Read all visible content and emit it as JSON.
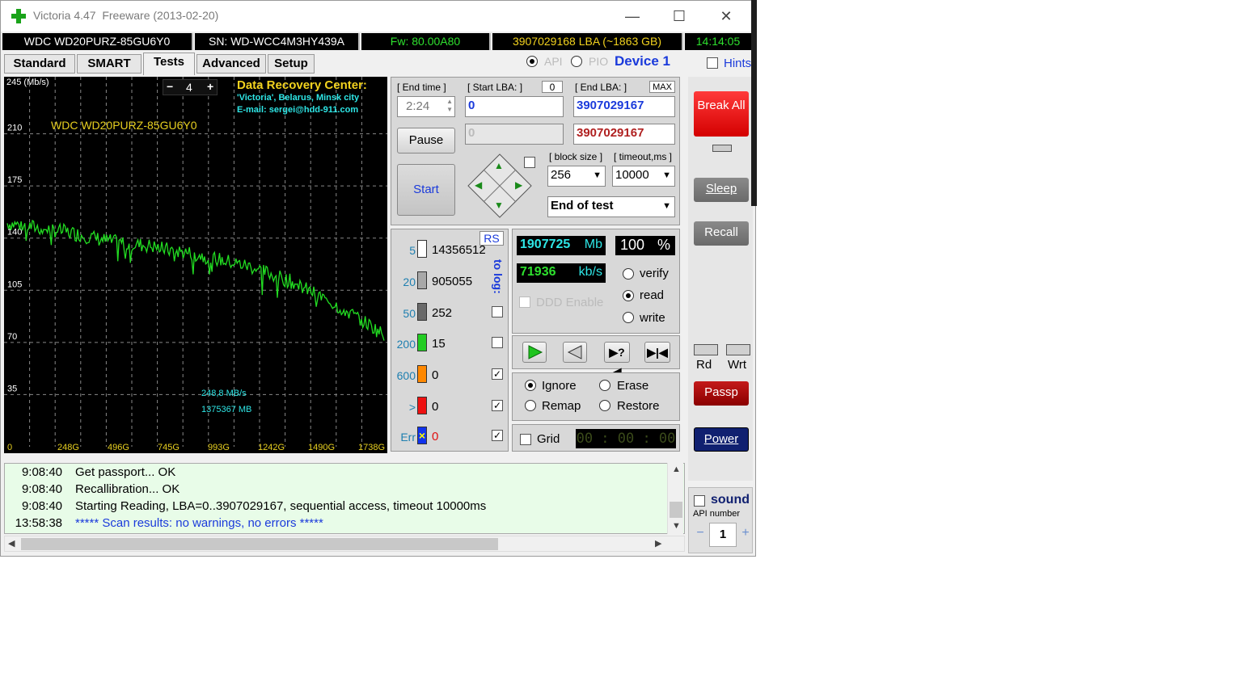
{
  "window": {
    "title": "Victoria 4.47  Freeware (2013-02-20)",
    "minimize": "—",
    "maximize": "☐",
    "close": "✕"
  },
  "info": {
    "model": "WDC WD20PURZ-85GU6Y0",
    "serial": "SN: WD-WCC4M3HY439A",
    "firmware": "Fw: 80.00A80",
    "lba": "3907029168 LBA (~1863 GB)",
    "time": "14:14:05"
  },
  "tabs": [
    "Standard",
    "SMART",
    "Tests",
    "Advanced",
    "Setup"
  ],
  "mode": {
    "api": "API",
    "pio": "PIO",
    "device": "Device 1",
    "hints": "Hints"
  },
  "graph": {
    "ymax_label": "245 (Mb/s)",
    "y_labels": [
      "210",
      "175",
      "140",
      "105",
      "70",
      "35"
    ],
    "x_labels": [
      "0",
      "248G",
      "496G",
      "745G",
      "993G",
      "1242G",
      "1490G",
      "1738G"
    ],
    "stepper_minus": "−",
    "stepper_value": "4",
    "stepper_plus": "+",
    "drc_title": "Data Recovery Center:",
    "drc_line1": "'Victoria', Belarus, Minsk city",
    "drc_line2": "E-mail: sergei@hdd-911.com",
    "drive_label": "WDC WD20PURZ-85GU6Y0",
    "speed_readout": "248,8 MB/s",
    "pos_readout": "1375367 MB"
  },
  "chart_data": {
    "type": "line",
    "ylabel": "(Mb/s)",
    "ylim": [
      0,
      245
    ],
    "x_ticks": [
      "0",
      "248G",
      "496G",
      "745G",
      "993G",
      "1242G",
      "1490G",
      "1738G"
    ],
    "x_gb": [
      0,
      100,
      200,
      300,
      400,
      500,
      600,
      700,
      800,
      900,
      1000,
      1100,
      1200,
      1300,
      1400,
      1500,
      1600,
      1700,
      1800,
      1863
    ],
    "y": [
      150,
      148,
      146,
      144,
      141,
      138,
      136,
      135,
      132,
      130,
      127,
      124,
      121,
      116,
      111,
      104,
      97,
      89,
      81,
      75
    ]
  },
  "controls": {
    "end_time_label": "[ End time ]",
    "end_time_value": "2:24",
    "start_lba_label": "[ Start LBA: ]",
    "start_lba_zero": "0",
    "start_lba_value": "0",
    "end_lba_label": "[ End LBA: ]",
    "end_lba_max": "MAX",
    "end_lba_value": "3907029167",
    "current_lba_value": "0",
    "end_lba_value2": "3907029167",
    "pause": "Pause",
    "start": "Start",
    "block_size_label": "[ block size ]",
    "block_size": "256",
    "timeout_label": "[ timeout,ms ]",
    "timeout": "10000",
    "end_of_test": "End of test"
  },
  "blocks": {
    "rs": "RS",
    "to_log": "to log:",
    "rows": [
      {
        "key": "5",
        "value": "14356512",
        "color": "#ffffff"
      },
      {
        "key": "20",
        "value": "905055",
        "color": "#a8a8a8"
      },
      {
        "key": "50",
        "value": "252",
        "color": "#6a6a6a"
      },
      {
        "key": "200",
        "value": "15",
        "color": "#22cc22"
      },
      {
        "key": "600",
        "value": "0",
        "color": "#ff8800"
      },
      {
        "key": ">",
        "value": "0",
        "color": "#ee1111"
      },
      {
        "key": "Err",
        "value": "0",
        "color": "#1133ee"
      }
    ]
  },
  "stats": {
    "mb_value": "1907725",
    "mb_unit": "Mb",
    "percent_value": "100",
    "percent_unit": "%",
    "speed_value": "71936",
    "speed_unit": "kb/s",
    "ddd": "DDD Enable",
    "verify": "verify",
    "read": "read",
    "write": "write"
  },
  "actions": {
    "ignore": "Ignore",
    "erase": "Erase",
    "remap": "Remap",
    "restore": "Restore",
    "grid": "Grid",
    "timer": "00 : 00 : 00"
  },
  "side": {
    "break_all": "Break All",
    "sleep": "Sleep",
    "recall": "Recall",
    "rd": "Rd",
    "wrt": "Wrt",
    "passp": "Passp",
    "power": "Power",
    "sound": "sound",
    "api_number_label": "API number",
    "api_minus": "−",
    "api_number": "1",
    "api_plus": "+"
  },
  "log": [
    {
      "time": "9:08:40",
      "msg": "Get passport... OK",
      "color": "#000000"
    },
    {
      "time": "9:08:40",
      "msg": "Recallibration... OK",
      "color": "#000000"
    },
    {
      "time": "9:08:40",
      "msg": "Starting Reading, LBA=0..3907029167, sequential access, timeout 10000ms",
      "color": "#000000"
    },
    {
      "time": "13:58:38",
      "msg": "***** Scan results: no warnings, no errors *****",
      "color": "#1a3adb"
    }
  ]
}
